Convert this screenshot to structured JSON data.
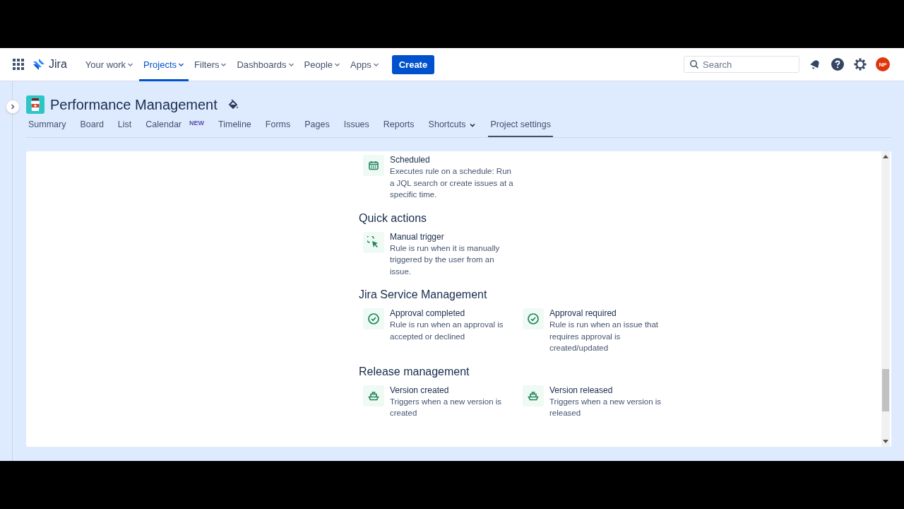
{
  "top_nav": {
    "product": "Jira",
    "items": [
      {
        "label": "Your work",
        "selected": false
      },
      {
        "label": "Projects",
        "selected": true
      },
      {
        "label": "Filters",
        "selected": false
      },
      {
        "label": "Dashboards",
        "selected": false
      },
      {
        "label": "People",
        "selected": false
      },
      {
        "label": "Apps",
        "selected": false
      }
    ],
    "create_button": "Create",
    "search": {
      "placeholder": "Search"
    },
    "avatar": "NP"
  },
  "project": {
    "title": "Performance Management"
  },
  "tabs": [
    {
      "label": "Summary",
      "selected": false
    },
    {
      "label": "Board",
      "selected": false
    },
    {
      "label": "List",
      "selected": false
    },
    {
      "label": "Calendar",
      "selected": false,
      "badge": "NEW"
    },
    {
      "label": "Timeline",
      "selected": false
    },
    {
      "label": "Forms",
      "selected": false
    },
    {
      "label": "Pages",
      "selected": false
    },
    {
      "label": "Issues",
      "selected": false
    },
    {
      "label": "Reports",
      "selected": false
    },
    {
      "label": "Shortcuts",
      "selected": false,
      "dropdown": true
    },
    {
      "label": "Project settings",
      "selected": true
    }
  ],
  "sections": [
    {
      "triggers": [
        {
          "kind": "calendar",
          "title": "Scheduled",
          "description": "Executes rule on a schedule: Run a JQL search or create issues at a specific time."
        }
      ]
    },
    {
      "heading": "Quick actions",
      "triggers": [
        {
          "kind": "cursor",
          "title": "Manual trigger",
          "description": "Rule is run when it is manually triggered by the user from an issue."
        }
      ]
    },
    {
      "heading": "Jira Service Management",
      "triggers": [
        {
          "kind": "check",
          "title": "Approval completed",
          "description": "Rule is run when an approval is accepted or declined"
        },
        {
          "kind": "check",
          "title": "Approval required",
          "description": "Rule is run when an issue that requires approval is created/updated"
        }
      ]
    },
    {
      "heading": "Release management",
      "triggers": [
        {
          "kind": "ship",
          "title": "Version created",
          "description": "Triggers when a new version is created"
        },
        {
          "kind": "ship",
          "title": "Version released",
          "description": "Triggers when a new version is released"
        }
      ]
    }
  ]
}
